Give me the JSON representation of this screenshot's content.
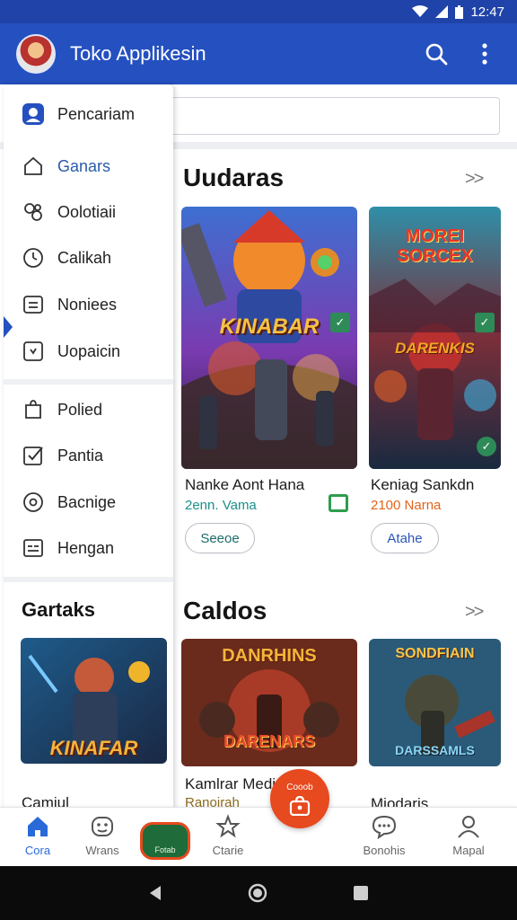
{
  "status": {
    "time": "12:47"
  },
  "app_bar": {
    "title": "Toko Applikesin"
  },
  "drawer": {
    "items_top": [
      {
        "label": "Pencariam",
        "icon": "account-icon"
      },
      {
        "label": "Ganars",
        "icon": "home-icon"
      },
      {
        "label": "Oolotiaii",
        "icon": "puzzle-icon"
      },
      {
        "label": "Calikah",
        "icon": "timer-icon"
      },
      {
        "label": "Noniees",
        "icon": "list-icon"
      },
      {
        "label": "Uopaicin",
        "icon": "download-icon"
      }
    ],
    "items_bottom": [
      {
        "label": "Polied",
        "icon": "bag-icon"
      },
      {
        "label": "Pantia",
        "icon": "checkbox-icon"
      },
      {
        "label": "Bacnige",
        "icon": "target-icon"
      },
      {
        "label": "Hengan",
        "icon": "grid-card-icon"
      }
    ],
    "section_title": "Gartaks",
    "card_partial_name": "Camiul",
    "card_title_art": "KINAFAR"
  },
  "section1": {
    "title": "Uudaras",
    "more": ">>",
    "cards": [
      {
        "name": "Nanke Aont Hana",
        "sub": "2enn. Vama",
        "button": "Seeoe",
        "art_title": "KINABAR",
        "sub_color": "#1c8f8a"
      },
      {
        "name": "Keniag Sankdn",
        "sub": "2100 Narna",
        "button": "Atahe",
        "art_title": "DARENKIS",
        "art_top": "MOREI SORCEX",
        "sub_color": "#e0641c"
      }
    ]
  },
  "section2": {
    "title": "Caldos",
    "more": ">>",
    "cards": [
      {
        "name": "Kamlrar Mediuan",
        "sub": "Ranoirah",
        "art_title": "DARENARS",
        "art_top": "DANRHINS"
      },
      {
        "name": "Miodaris",
        "sub": "",
        "art_title": "DARSSAMLS",
        "art_top": "SONDFIAIN"
      }
    ]
  },
  "bottom_nav": {
    "items": [
      {
        "label": "Cora",
        "icon": "home-icon"
      },
      {
        "label": "Wrans",
        "icon": "game-face-icon"
      },
      {
        "label": "Ctarie",
        "icon": "star-outline-icon"
      },
      {
        "label": "Bonohis",
        "icon": "chat-bubble-icon"
      },
      {
        "label": "Mapal",
        "icon": "profile-icon"
      }
    ],
    "fab_label": "Cooob",
    "promo_label": "Fotab"
  },
  "colors": {
    "primary": "#2550c0",
    "status": "#1f43a8",
    "accent": "#e64a1e",
    "teal": "#1c8f8a",
    "orange": "#e0641c"
  }
}
